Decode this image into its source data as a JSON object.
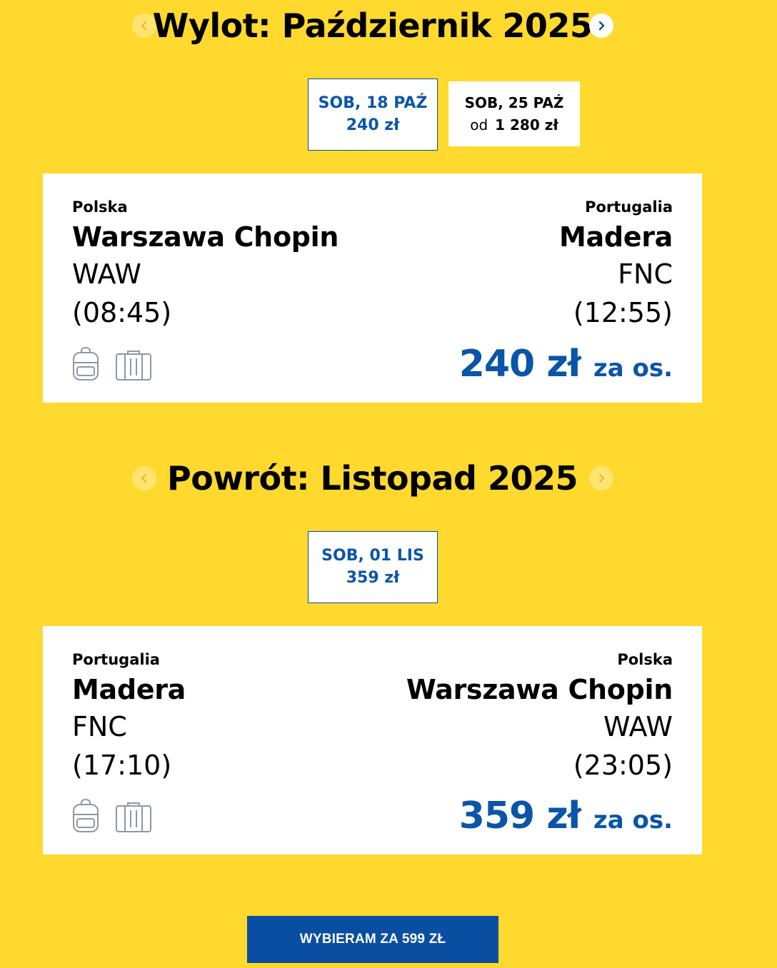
{
  "outbound": {
    "title": "Wylot: Październik 2025",
    "prev_icon": "chevron-left-icon",
    "next_icon": "chevron-right-icon",
    "dates": [
      {
        "day": "SOB, 18 PAŹ",
        "price": "240 zł",
        "selected": true
      },
      {
        "day": "SOB, 25 PAŹ",
        "from_label": "od",
        "price": "1 280 zł",
        "selected": false
      }
    ],
    "card": {
      "origin_country": "Polska",
      "origin_city": "Warszawa Chopin",
      "origin_code": "WAW",
      "departure_time": "(08:45)",
      "destination_country": "Portugalia",
      "destination_city": "Madera",
      "destination_code": "FNC",
      "arrival_time": "(12:55)",
      "price": "240 zł",
      "per_person": "za os.",
      "icons": [
        "backpack-icon",
        "suitcase-icon"
      ]
    }
  },
  "return": {
    "title": "Powrót: Listopad 2025",
    "prev_icon": "chevron-left-icon",
    "next_icon": "chevron-right-icon",
    "dates": [
      {
        "day": "SOB, 01 LIS",
        "price": "359 zł",
        "selected": true
      }
    ],
    "card": {
      "origin_country": "Portugalia",
      "origin_city": "Madera",
      "origin_code": "FNC",
      "departure_time": "(17:10)",
      "destination_country": "Polska",
      "destination_city": "Warszawa Chopin",
      "destination_code": "WAW",
      "arrival_time": "(23:05)",
      "price": "359 zł",
      "per_person": "za os.",
      "icons": [
        "backpack-icon",
        "suitcase-icon"
      ]
    }
  },
  "cta": {
    "label": "WYBIERAM ZA 599 ZŁ"
  },
  "colors": {
    "background": "#FFD92E",
    "accent_blue": "#0A55A8",
    "button_blue": "#0A4EA2",
    "card": "#FFFFFF"
  }
}
